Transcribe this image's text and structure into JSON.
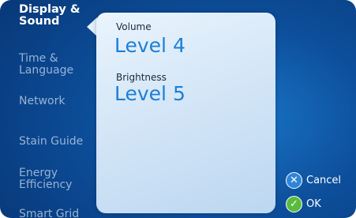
{
  "menu": {
    "items": [
      {
        "label_line1": "Display &",
        "label_line2": "Sound",
        "active": true
      },
      {
        "label_line1": "Time &",
        "label_line2": "Language",
        "active": false
      },
      {
        "label_line1": "Network",
        "label_line2": "",
        "active": false
      },
      {
        "label_line1": "Stain Guide",
        "label_line2": "",
        "active": false
      },
      {
        "label_line1": "Energy",
        "label_line2": "Efficiency",
        "active": false
      },
      {
        "label_line1": "Smart Grid",
        "label_line2": "",
        "active": false
      }
    ]
  },
  "settings": {
    "volume_label": "Volume",
    "volume_value": "Level 4",
    "brightness_label": "Brightness",
    "brightness_value": "Level 5"
  },
  "actions": {
    "cancel_label": "Cancel",
    "ok_label": "OK",
    "cancel_icon": "x-icon",
    "ok_icon": "checkmark-icon"
  },
  "colors": {
    "background": "#0d4f9c",
    "value_text": "#1d7fd6",
    "cancel_accent": "#2f86d8",
    "ok_accent": "#5bbb3e"
  }
}
